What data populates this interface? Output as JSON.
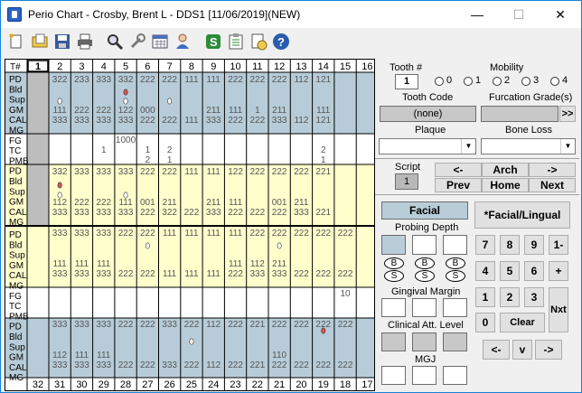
{
  "window": {
    "title": "Perio Chart - Crosby, Brent L - DDS1 [11/06/2019](NEW)",
    "min": "—",
    "max": "☐",
    "close": "✕"
  },
  "toolbar": {
    "icons": [
      "new-icon",
      "open-folder-icon",
      "save-icon",
      "print-icon",
      "search-icon",
      "wrench-icon",
      "calculator-icon",
      "doctor-icon",
      "s-badge-icon",
      "clipboard-icon",
      "notes-icon",
      "help-icon"
    ]
  },
  "grid": {
    "header": "T#",
    "top_teeth": [
      "1",
      "2",
      "3",
      "4",
      "5",
      "6",
      "7",
      "8",
      "9",
      "10",
      "11",
      "12",
      "13",
      "14",
      "15",
      "16"
    ],
    "bottom_teeth": [
      "32",
      "31",
      "30",
      "29",
      "28",
      "27",
      "26",
      "25",
      "24",
      "23",
      "22",
      "21",
      "20",
      "19",
      "18",
      "17"
    ],
    "row_labels_upper": [
      "PD",
      "Bld",
      "Sup",
      "GM",
      "CAL",
      "MG",
      "FG",
      "TC",
      "PMB",
      "PD",
      "Bld",
      "Sup",
      "GM",
      "CAL",
      "MG"
    ],
    "row_labels_lower": [
      "PD",
      "Bld",
      "Sup",
      "GM",
      "CAL",
      "MG",
      "FG",
      "TC",
      "PMB",
      "PD",
      "Bld",
      "Sup",
      "GM",
      "CAL",
      "MG"
    ],
    "upper_facial_pd": [
      "",
      "322",
      "233",
      "333",
      "332",
      "222",
      "222",
      "111",
      "111",
      "222",
      "222",
      "222",
      "112",
      "121"
    ],
    "upper_facial_gm": [
      "",
      "111",
      "222",
      "222",
      "122",
      "000",
      "",
      "",
      "211",
      "111",
      "1",
      "211",
      "",
      "111"
    ],
    "upper_facial_cal": [
      "",
      "333",
      "333",
      "333",
      "333",
      "222",
      "222",
      "111",
      "333",
      "222",
      "222",
      "333",
      "112",
      "121"
    ],
    "upper_fg": [
      "",
      "",
      "",
      "",
      "1000",
      "",
      "",
      "",
      "",
      "",
      "",
      "",
      "",
      "",
      ""
    ],
    "upper_tc": [
      "",
      "",
      "",
      "1",
      "",
      "1",
      "2",
      "",
      "",
      "",
      "",
      "",
      "",
      "2"
    ],
    "upper_pmb": [
      "",
      "",
      "",
      "",
      "",
      "2",
      "1",
      "",
      "",
      "",
      "",
      "",
      "",
      "1"
    ],
    "upper_lingual_pd": [
      "",
      "332",
      "333",
      "333",
      "333",
      "222",
      "222",
      "111",
      "111",
      "122",
      "222",
      "222",
      "222",
      "221"
    ],
    "upper_lingual_gm": [
      "",
      "112",
      "222",
      "222",
      "111",
      "001",
      "211",
      "",
      "211",
      "111",
      "",
      "001",
      "211",
      ""
    ],
    "upper_lingual_cal": [
      "",
      "333",
      "333",
      "333",
      "333",
      "222",
      "322",
      "222",
      "333",
      "222",
      "222",
      "222",
      "333",
      "221"
    ],
    "lower_lingual_pd": [
      "",
      "333",
      "333",
      "333",
      "222",
      "222",
      "111",
      "111",
      "111",
      "111",
      "222",
      "222",
      "222",
      "222",
      "222"
    ],
    "lower_lingual_gm": [
      "",
      "111",
      "111",
      "111",
      "",
      "",
      "",
      "",
      "",
      "111",
      "112",
      "211",
      "",
      "",
      ""
    ],
    "lower_lingual_cal": [
      "",
      "333",
      "333",
      "333",
      "222",
      "222",
      "111",
      "111",
      "111",
      "222",
      "333",
      "333",
      "222",
      "222",
      "222"
    ],
    "lower_tc_15": "10",
    "lower_facial_pd": [
      "",
      "333",
      "333",
      "333",
      "222",
      "222",
      "333",
      "222",
      "112",
      "222",
      "221",
      "222",
      "222",
      "222",
      "222"
    ],
    "lower_facial_gm": [
      "",
      "112",
      "111",
      "111",
      "",
      "",
      "",
      "",
      "",
      "",
      "",
      "110",
      "",
      "",
      ""
    ],
    "lower_facial_cal": [
      "",
      "333",
      "333",
      "333",
      "222",
      "222",
      "333",
      "222",
      "112",
      "222",
      "221",
      "222",
      "222",
      "222",
      "222"
    ]
  },
  "right": {
    "tooth_label": "Tooth #",
    "tooth_value": "1",
    "mobility_label": "Mobility",
    "mobility_options": [
      "0",
      "1",
      "2",
      "3",
      "4"
    ],
    "tooth_code_label": "Tooth Code",
    "tooth_code_value": "(none)",
    "furcation_label": "Furcation Grade(s)",
    "furcation_btn": ">>",
    "plaque_label": "Plaque",
    "bone_loss_label": "Bone Loss",
    "script_label": "Script",
    "script_value": "1",
    "nav": {
      "back": "<-",
      "arch": "Arch",
      "fwd": "->",
      "prev": "Prev",
      "home": "Home",
      "next": "Next"
    },
    "facial_btn": "Facial",
    "facial_lingual_btn": "*Facial/Lingual",
    "probing_label": "Probing Depth",
    "bs": [
      "B",
      "B",
      "B"
    ],
    "ss": [
      "S",
      "S",
      "S"
    ],
    "gingival_label": "Gingival Margin",
    "cal_label": "Clinical Att. Level",
    "mgj_label": "MGJ",
    "keys": [
      "7",
      "8",
      "9",
      "1-",
      "4",
      "5",
      "6",
      "+",
      "1",
      "2",
      "3",
      "Nxt",
      "0",
      "Clear",
      "<-",
      "v",
      "->"
    ]
  }
}
